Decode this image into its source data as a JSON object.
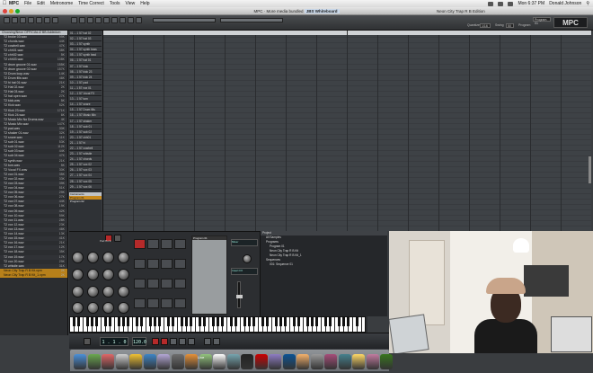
{
  "menubar": {
    "app": "MPC",
    "items": [
      "File",
      "Edit",
      "Metronome",
      "Time Correct",
      "Tools",
      "View",
      "Help"
    ],
    "clock": "Mon 6:37 PM",
    "user": "Donald Johnson"
  },
  "window": {
    "title": "MPC",
    "title_suffix": "More media bundled",
    "title_note": "JBS Whiteboard",
    "right_title": "Neon City Trap R B Edition"
  },
  "browser": {
    "header": "Choosing/Neon OFFICIAL/Z BB Addedum",
    "rows": [
      {
        "name": "T2 broke 03.wav",
        "size": "99K"
      },
      {
        "name": "T2 chords.wav",
        "size": "44K"
      },
      {
        "name": "T2 cowbell.wav",
        "size": "47K"
      },
      {
        "name": "T2 chh01.wav",
        "size": "38K"
      },
      {
        "name": "T2 chh02.wav",
        "size": "5K"
      },
      {
        "name": "T2 chh03.wav",
        "size": "108K"
      },
      {
        "name": "T2 drum groove 01.wav",
        "size": "155K"
      },
      {
        "name": "T2 drum groove 02.wav",
        "size": "157K"
      },
      {
        "name": "T2 Drum loop.wav",
        "size": "14K"
      },
      {
        "name": "T2 Drum fills.wav",
        "size": "46K"
      },
      {
        "name": "T2 hi hat 01.wav",
        "size": "21K"
      },
      {
        "name": "T2 Hat 02.wav",
        "size": "2K"
      },
      {
        "name": "T2 Hat 03.wav",
        "size": "2K"
      },
      {
        "name": "T2 hat open.wav",
        "size": "27K"
      },
      {
        "name": "T2 kick.wav",
        "size": "5K"
      },
      {
        "name": "T2 Kick.wav",
        "size": "52K"
      },
      {
        "name": "T2 Kick 23.wav",
        "size": "171K"
      },
      {
        "name": "T2 Kick 24.wav",
        "size": "6K"
      },
      {
        "name": "T2 Music Mix No Drums.wav",
        "size": "4K"
      },
      {
        "name": "T2 Music Mix.wav",
        "size": "147K"
      },
      {
        "name": "T2 pad.wav",
        "size": "30K"
      },
      {
        "name": "T2 shaker 01.wav",
        "size": "32K"
      },
      {
        "name": "T2 snare.wav",
        "size": "11K"
      },
      {
        "name": "T2 sub 01.wav",
        "size": "53K"
      },
      {
        "name": "T2 sub 02.wav",
        "size": "112K"
      },
      {
        "name": "T2 sub 03.wav",
        "size": "44K"
      },
      {
        "name": "T2 sub 04.wav",
        "size": "47K"
      },
      {
        "name": "T2 synth.wav",
        "size": "21K"
      },
      {
        "name": "T2 tom.wav",
        "size": "5K"
      },
      {
        "name": "T2 Vocal FX.wav",
        "size": "30K"
      },
      {
        "name": "T2 vox 01.wav",
        "size": "35K"
      },
      {
        "name": "T2 vox 02.wav",
        "size": "33K"
      },
      {
        "name": "T2 vox 03.wav",
        "size": "39K"
      },
      {
        "name": "T2 vox 04.wav",
        "size": "51K"
      },
      {
        "name": "T2 vox 05.wav",
        "size": "29K"
      },
      {
        "name": "T2 vox 06.wav",
        "size": "27K"
      },
      {
        "name": "T2 vox 07.wav",
        "size": "44K"
      },
      {
        "name": "T2 vox 08.wav",
        "size": "19K"
      },
      {
        "name": "T2 vox 09.wav",
        "size": "42K"
      },
      {
        "name": "T2 vox 10.wav",
        "size": "59K"
      },
      {
        "name": "T2 vox 11.wav",
        "size": "28K"
      },
      {
        "name": "T2 vox 12.wav",
        "size": "23K"
      },
      {
        "name": "T2 vox 13.wav",
        "size": "46K"
      },
      {
        "name": "T2 vox 14.wav",
        "size": "13K"
      },
      {
        "name": "T2 vox 15.wav",
        "size": "41K"
      },
      {
        "name": "T2 vox 16.wav",
        "size": "21K"
      },
      {
        "name": "T2 vox 17.wav",
        "size": "12K"
      },
      {
        "name": "T2 vox 18.wav",
        "size": "35K"
      },
      {
        "name": "T2 vox 19.wav",
        "size": "17K"
      },
      {
        "name": "T2 vox 20.wav",
        "size": "29K"
      },
      {
        "name": "T2 whistle.wav",
        "size": "31K"
      },
      {
        "name": "Neon City Trap R B Kit.xpm",
        "size": "2K"
      },
      {
        "name": "Neon City Trap R B Kit_1.xpm",
        "size": "2K"
      }
    ]
  },
  "tracks": [
    "01 -- 1 57 hat 02",
    "02 -- 1 57 hat 03",
    "03 -- 1 57 synth",
    "04 -- 1 57 synth bass",
    "05 -- 1 57 synth lead",
    "06 -- 1 57 hat 01",
    "07 -- 1 57 kick",
    "08 -- 1 57 kick 23",
    "09 -- 1 57 kick 24",
    "10 -- 1 57 pad",
    "11 -- 1 57 vox 01",
    "12 -- 1 57 Vocal FX",
    "13 -- 1 57 tom",
    "14 -- 1 57 snare",
    "15 -- 1 57 Drum fills",
    "16 -- 1 57 Music Mix",
    "17 -- 1 57 shaker",
    "18 -- 1 57 sub 01",
    "19 -- 1 57 sub 02",
    "20 -- 1 57 chh01",
    "21 -- 1 57 hi",
    "22 -- 1 57 cowbell",
    "23 -- 1 57 whistle",
    "24 -- 1 57 chords",
    "25 -- 1 57 vox 02",
    "26 -- 1 57 vox 03",
    "27 -- 1 57 vox 04",
    "28 -- 1 57 vox 05",
    "29 -- 1 57 vox 06"
  ],
  "program_list": {
    "header": "Instruments",
    "items": [
      "Program 01",
      "Program 02"
    ]
  },
  "toolbar": {
    "quantize_label": "Quantize",
    "quantize_value": "1/16",
    "swing_label": "Swing",
    "swing_value": "50",
    "program_label": "Program",
    "program_value": "Program 01",
    "brand": "MPC"
  },
  "mpc": {
    "screen_title": "Program 01",
    "pad_bank": "Pad Bank",
    "channel_strip": "Mixer",
    "fx_label": "Insert FX"
  },
  "project": {
    "header": "Project",
    "items": [
      "All Samples",
      "Programs",
      "Program 01",
      "Neon City Trap R B Kit",
      "Neon City Trap R B Kit_1",
      "Sequences",
      "001: Sequence 01"
    ]
  },
  "status": {
    "position": "1 . 1 . 0",
    "tempo": "120.0"
  },
  "dock": {
    "live_label": "Live",
    "colors": [
      "#4a90d9",
      "#6aa84f",
      "#e06666",
      "#cfcfcf",
      "#f1c232",
      "#3d85c6",
      "#b4a7d6",
      "#6d6d6d",
      "#e69138",
      "#93c47d",
      "#ffffff",
      "#76a5af",
      "#222222",
      "#cc0000",
      "#8e7cc3",
      "#0b5394",
      "#f6b26b",
      "#999999",
      "#a64d79",
      "#45818e",
      "#ffd966",
      "#c27ba0",
      "#38761d"
    ]
  }
}
